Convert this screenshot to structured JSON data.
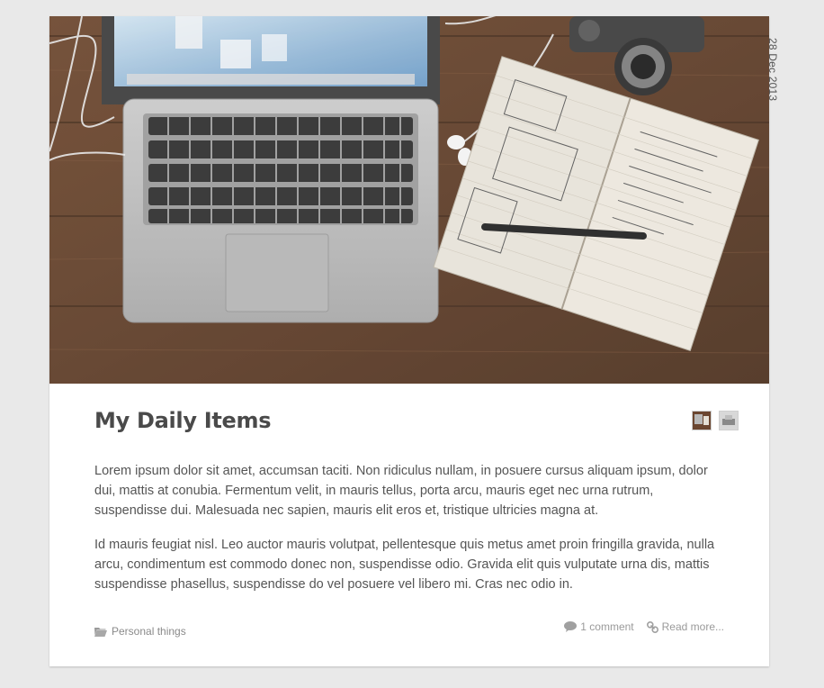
{
  "post": {
    "title": "My Daily Items",
    "date": "28 Dec 2013",
    "paragraphs": [
      "Lorem ipsum dolor sit amet, accumsan taciti. Non ridiculus nullam, in posuere cursus aliquam ipsum, dolor dui, mattis at conubia. Fermentum velit, in mauris tellus, porta arcu, mauris eget nec urna rutrum, suspendisse dui. Malesuada nec sapien, mauris elit eros et, tristique ultricies magna at.",
      "Id mauris feugiat nisl. Leo auctor mauris volutpat, pellentesque quis metus amet proin fringilla gravida, nulla arcu, condimentum est commodo donec non, suspendisse odio. Gravida elit quis vulputate urna dis, mattis suspendisse phasellus, suspendisse do vel posuere vel libero mi. Cras nec odio in."
    ],
    "category": "Personal things",
    "comments": "1 comment",
    "read_more": "Read more..."
  },
  "icons": {
    "category": "folder-icon",
    "comments": "comment-bubble-icon",
    "read_more": "link-icon"
  },
  "colors": {
    "background": "#e9e9e9",
    "card": "#ffffff",
    "title": "#4a4a4a",
    "text": "#555555",
    "meta": "#9a9a9a"
  }
}
